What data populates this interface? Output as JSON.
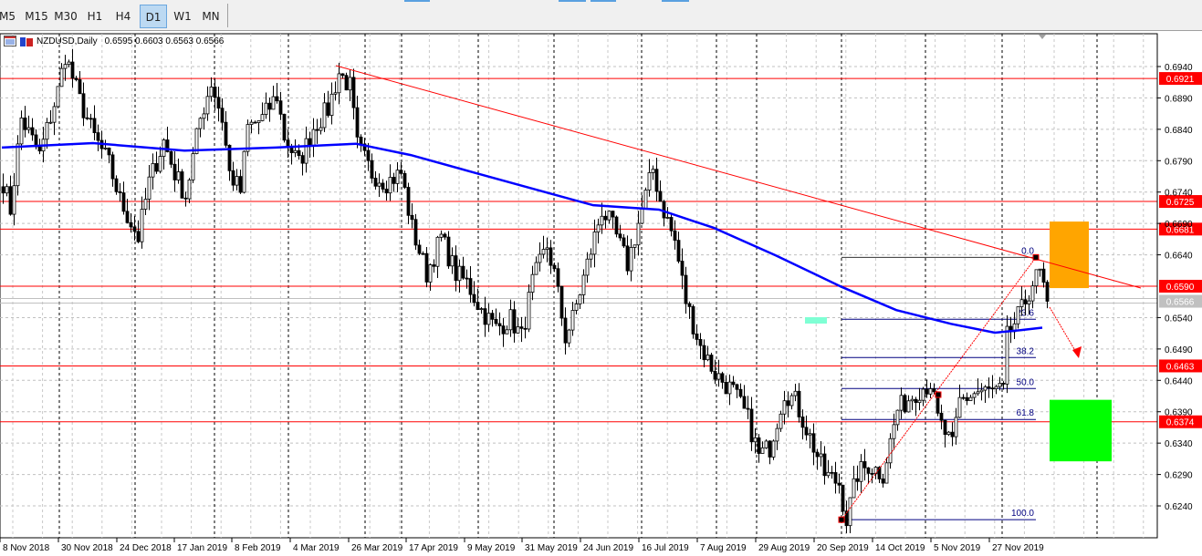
{
  "toolbar": {
    "timeframes": [
      "M5",
      "M15",
      "M30",
      "H1",
      "H4",
      "D1",
      "W1",
      "MN"
    ],
    "active": "D1"
  },
  "chart": {
    "symbol_info": "NZDUSD,Daily",
    "ohlc_text": "0.6595 0.6603 0.6563 0.6566",
    "price_axis": [
      "0.6940",
      "0.6890",
      "0.6840",
      "0.6790",
      "0.6740",
      "0.6690",
      "0.6640",
      "0.6540",
      "0.6490",
      "0.6440",
      "0.6390",
      "0.6340",
      "0.6290",
      "0.6240"
    ],
    "date_axis": [
      "8 Nov 2018",
      "30 Nov 2018",
      "24 Dec 2018",
      "17 Jan 2019",
      "8 Feb 2019",
      "4 Mar 2019",
      "26 Mar 2019",
      "17 Apr 2019",
      "9 May 2019",
      "31 May 2019",
      "24 Jun 2019",
      "16 Jul 2019",
      "7 Aug 2019",
      "29 Aug 2019",
      "20 Sep 2019",
      "14 Oct 2019",
      "5 Nov 2019",
      "27 Nov 2019"
    ],
    "levels": [
      {
        "price": 0.6921,
        "label": "0.6921",
        "color": "#ff0000"
      },
      {
        "price": 0.6725,
        "label": "0.6725",
        "color": "#ff0000"
      },
      {
        "price": 0.6681,
        "label": "0.6681",
        "color": "#ff0000"
      },
      {
        "price": 0.659,
        "label": "0.6590",
        "color": "#ff0000"
      },
      {
        "price": 0.6566,
        "label": "0.6566",
        "color": "#c0c0c0"
      },
      {
        "price": 0.6463,
        "label": "0.6463",
        "color": "#ff0000"
      },
      {
        "price": 0.6374,
        "label": "0.6374",
        "color": "#ff0000"
      }
    ],
    "fibonacci": {
      "high": 0.6636,
      "low": 0.6218,
      "levels": [
        {
          "ratio": 0.0,
          "label": "0.0"
        },
        {
          "ratio": 0.236,
          "label": "23.6"
        },
        {
          "ratio": 0.382,
          "label": "38.2"
        },
        {
          "ratio": 0.5,
          "label": "50.0"
        },
        {
          "ratio": 0.618,
          "label": "61.8"
        },
        {
          "ratio": 1.0,
          "label": "100.0"
        }
      ]
    },
    "price_waypoints": [
      [
        0,
        0.6756
      ],
      [
        2,
        0.6712
      ],
      [
        5,
        0.6857
      ],
      [
        10,
        0.6799
      ],
      [
        15,
        0.6901
      ],
      [
        17,
        0.6959
      ],
      [
        21,
        0.6886
      ],
      [
        25,
        0.6828
      ],
      [
        29,
        0.6785
      ],
      [
        32,
        0.6727
      ],
      [
        37,
        0.6668
      ],
      [
        40,
        0.6756
      ],
      [
        44,
        0.6821
      ],
      [
        47,
        0.677
      ],
      [
        50,
        0.6734
      ],
      [
        54,
        0.6857
      ],
      [
        57,
        0.6915
      ],
      [
        60,
        0.6857
      ],
      [
        62,
        0.677
      ],
      [
        65,
        0.6741
      ],
      [
        67,
        0.6843
      ],
      [
        71,
        0.6857
      ],
      [
        75,
        0.6894
      ],
      [
        77,
        0.6828
      ],
      [
        81,
        0.6785
      ],
      [
        85,
        0.6843
      ],
      [
        89,
        0.6872
      ],
      [
        92,
        0.693
      ],
      [
        95,
        0.6908
      ],
      [
        97,
        0.6814
      ],
      [
        101,
        0.677
      ],
      [
        105,
        0.6756
      ],
      [
        109,
        0.677
      ],
      [
        112,
        0.6683
      ],
      [
        116,
        0.661
      ],
      [
        120,
        0.6668
      ],
      [
        124,
        0.661
      ],
      [
        127,
        0.6596
      ],
      [
        131,
        0.6552
      ],
      [
        135,
        0.6523
      ],
      [
        139,
        0.6538
      ],
      [
        142,
        0.6509
      ],
      [
        145,
        0.6596
      ],
      [
        149,
        0.6654
      ],
      [
        151,
        0.661
      ],
      [
        154,
        0.6509
      ],
      [
        156,
        0.6538
      ],
      [
        160,
        0.6625
      ],
      [
        164,
        0.6712
      ],
      [
        167,
        0.6683
      ],
      [
        171,
        0.6625
      ],
      [
        175,
        0.6712
      ],
      [
        178,
        0.6777
      ],
      [
        180,
        0.6727
      ],
      [
        184,
        0.6661
      ],
      [
        187,
        0.6567
      ],
      [
        191,
        0.6494
      ],
      [
        195,
        0.6451
      ],
      [
        200,
        0.6422
      ],
      [
        204,
        0.6378
      ],
      [
        207,
        0.632
      ],
      [
        210,
        0.6334
      ],
      [
        214,
        0.6422
      ],
      [
        217,
        0.6407
      ],
      [
        221,
        0.6349
      ],
      [
        225,
        0.6291
      ],
      [
        229,
        0.6276
      ],
      [
        231,
        0.6218
      ],
      [
        234,
        0.6291
      ],
      [
        237,
        0.6305
      ],
      [
        241,
        0.6291
      ],
      [
        245,
        0.6393
      ],
      [
        250,
        0.6422
      ],
      [
        254,
        0.6436
      ],
      [
        256,
        0.6378
      ],
      [
        260,
        0.6334
      ],
      [
        262,
        0.6407
      ],
      [
        267,
        0.6422
      ],
      [
        274,
        0.6422
      ],
      [
        275,
        0.6509
      ],
      [
        279,
        0.6552
      ],
      [
        282,
        0.6596
      ],
      [
        284,
        0.661
      ],
      [
        286,
        0.6566
      ]
    ],
    "ma_points": [
      [
        0,
        0.6811
      ],
      [
        25,
        0.6818
      ],
      [
        50,
        0.6806
      ],
      [
        75,
        0.6811
      ],
      [
        97,
        0.6817
      ],
      [
        112,
        0.6799
      ],
      [
        130,
        0.677
      ],
      [
        150,
        0.6738
      ],
      [
        162,
        0.6719
      ],
      [
        180,
        0.6712
      ],
      [
        195,
        0.6683
      ],
      [
        212,
        0.6639
      ],
      [
        230,
        0.6589
      ],
      [
        245,
        0.6552
      ],
      [
        260,
        0.653
      ],
      [
        272,
        0.6516
      ],
      [
        279,
        0.652
      ],
      [
        285,
        0.6524
      ]
    ],
    "colors": {
      "ma": "#0000ff",
      "trend": "#ff0000",
      "sell_zone": "#ffa500",
      "target_zone": "#00ff00",
      "marker": "#7fffd4",
      "fib": "#000080"
    }
  }
}
